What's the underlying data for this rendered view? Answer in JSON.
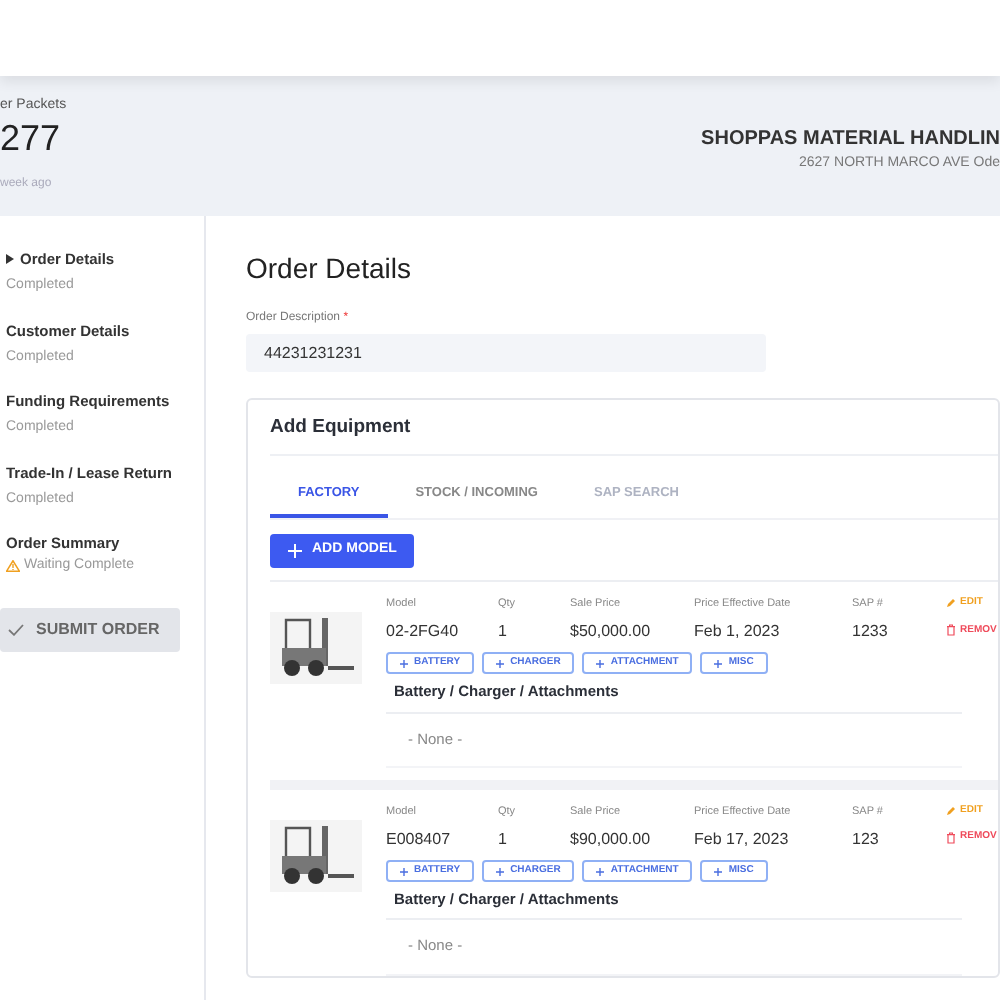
{
  "header": {
    "packets_label": "er Packets",
    "packets_count": "277",
    "updated": "week ago",
    "company_name": "SHOPPAS MATERIAL HANDLIN",
    "company_address": "2627 NORTH MARCO AVE Ode"
  },
  "steps": [
    {
      "title": "Order Details",
      "status": "Completed",
      "warning": false,
      "current": true
    },
    {
      "title": "Customer Details",
      "status": "Completed",
      "warning": false,
      "current": false
    },
    {
      "title": "Funding Requirements",
      "status": "Completed",
      "warning": false,
      "current": false
    },
    {
      "title": "Trade-In / Lease Return",
      "status": "Completed",
      "warning": false,
      "current": false
    },
    {
      "title": "Order Summary",
      "status": "Waiting Complete",
      "warning": true,
      "current": false
    }
  ],
  "submit_button": "SUBMIT ORDER",
  "page_title": "Order Details",
  "order_description": {
    "label": "Order Description",
    "required_mark": "*",
    "value": "44231231231"
  },
  "equipment": {
    "title": "Add Equipment",
    "tabs": [
      {
        "label": "FACTORY",
        "selected": true,
        "disabled": false
      },
      {
        "label": "STOCK / INCOMING",
        "selected": false,
        "disabled": false
      },
      {
        "label": "SAP SEARCH",
        "selected": false,
        "disabled": true
      }
    ],
    "add_button": "ADD MODEL",
    "items": [
      {
        "fields": [
          {
            "label": "Model",
            "value": "02-2FG40"
          },
          {
            "label": "Qty",
            "value": "1"
          },
          {
            "label": "Sale Price",
            "value": "$50,000.00"
          },
          {
            "label": "Price Effective Date",
            "value": "Feb 1, 2023"
          },
          {
            "label": "SAP #",
            "value": "1233"
          }
        ],
        "accessory_buttons": [
          "BATTERY",
          "CHARGER",
          "ATTACHMENT",
          "MISC"
        ],
        "edit": "EDIT",
        "remove": "REMOV",
        "accessories_title": "Battery / Charger / Attachments",
        "accessories_empty": "- None -"
      },
      {
        "fields": [
          {
            "label": "Model",
            "value": "E008407"
          },
          {
            "label": "Qty",
            "value": "1"
          },
          {
            "label": "Sale Price",
            "value": "$90,000.00"
          },
          {
            "label": "Price Effective Date",
            "value": "Feb 17, 2023"
          },
          {
            "label": "SAP #",
            "value": "123"
          }
        ],
        "accessory_buttons": [
          "BATTERY",
          "CHARGER",
          "ATTACHMENT",
          "MISC"
        ],
        "edit": "EDIT",
        "remove": "REMOV",
        "accessories_title": "Battery / Charger / Attachments",
        "accessories_empty": "- None -"
      }
    ]
  }
}
